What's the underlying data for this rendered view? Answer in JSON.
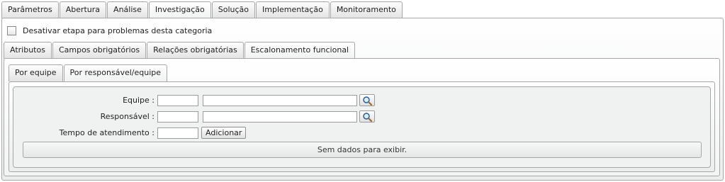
{
  "top_tabs": [
    {
      "label": "Parâmetros"
    },
    {
      "label": "Abertura"
    },
    {
      "label": "Análise"
    },
    {
      "label": "Investigação"
    },
    {
      "label": "Solução"
    },
    {
      "label": "Implementação"
    },
    {
      "label": "Monitoramento"
    }
  ],
  "active_top_tab": "Investigação",
  "disable_checkbox": {
    "label": "Desativar etapa para problemas desta categoria",
    "checked": false
  },
  "sub_tabs": [
    {
      "label": "Atributos"
    },
    {
      "label": "Campos obrigatórios"
    },
    {
      "label": "Relações obrigatórias"
    },
    {
      "label": "Escalonamento funcional"
    }
  ],
  "active_sub_tab": "Escalonamento funcional",
  "inner_tabs": [
    {
      "label": "Por equipe"
    },
    {
      "label": "Por responsável/equipe"
    }
  ],
  "active_inner_tab": "Por responsável/equipe",
  "form": {
    "team_label": "Equipe :",
    "team_code": "",
    "team_name": "",
    "responsible_label": "Responsável :",
    "responsible_code": "",
    "responsible_name": "",
    "time_label": "Tempo de atendimento :",
    "time_value": "",
    "add_button": "Adicionar"
  },
  "grid": {
    "empty_message": "Sem dados para exibir."
  },
  "icons": {
    "search": "magnifier-icon"
  }
}
